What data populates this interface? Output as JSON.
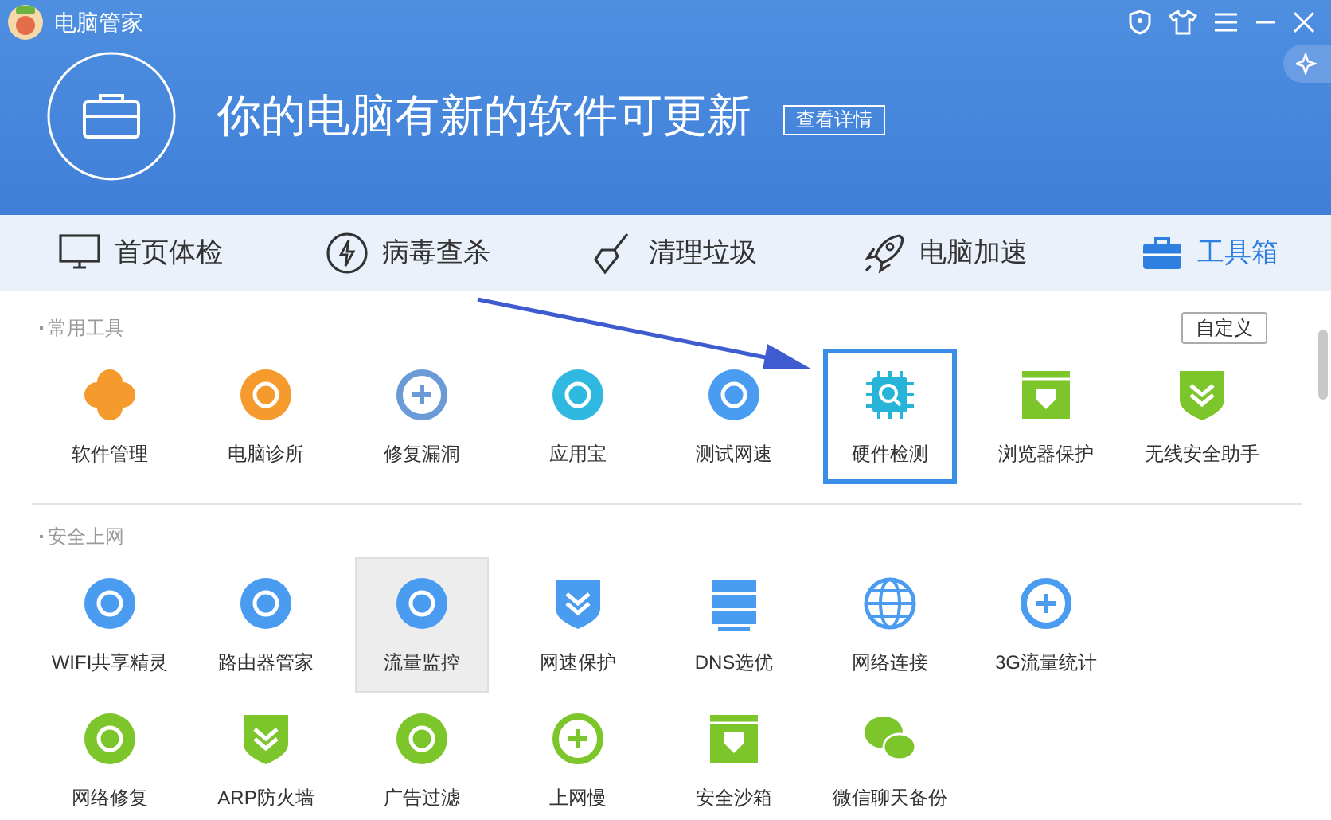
{
  "window": {
    "title": "电脑管家"
  },
  "banner": {
    "headline": "你的电脑有新的软件可更新",
    "button": "查看详情"
  },
  "tabs": [
    {
      "label": "首页体检",
      "selected": false
    },
    {
      "label": "病毒查杀",
      "selected": false
    },
    {
      "label": "清理垃圾",
      "selected": false
    },
    {
      "label": "电脑加速",
      "selected": false
    },
    {
      "label": "工具箱",
      "selected": true
    }
  ],
  "customize_button": "自定义",
  "sections": [
    {
      "title": "常用工具",
      "tools": [
        {
          "label": "软件管理",
          "color": "#f59a2c",
          "selected": false,
          "hovered": false
        },
        {
          "label": "电脑诊所",
          "color": "#f59a2c",
          "selected": false,
          "hovered": false
        },
        {
          "label": "修复漏洞",
          "color": "#6b9bd6",
          "selected": false,
          "hovered": false
        },
        {
          "label": "应用宝",
          "color": "#2fb8e0",
          "selected": false,
          "hovered": false
        },
        {
          "label": "测试网速",
          "color": "#4a9cf0",
          "selected": false,
          "hovered": false
        },
        {
          "label": "硬件检测",
          "color": "#26b4d8",
          "selected": true,
          "hovered": false
        },
        {
          "label": "浏览器保护",
          "color": "#7cc52a",
          "selected": false,
          "hovered": false
        },
        {
          "label": "无线安全助手",
          "color": "#7cc52a",
          "selected": false,
          "hovered": false
        }
      ]
    },
    {
      "title": "安全上网",
      "tools": [
        {
          "label": "WIFI共享精灵",
          "color": "#4a9cf0",
          "selected": false,
          "hovered": false
        },
        {
          "label": "路由器管家",
          "color": "#4a9cf0",
          "selected": false,
          "hovered": false
        },
        {
          "label": "流量监控",
          "color": "#4a9cf0",
          "selected": false,
          "hovered": true
        },
        {
          "label": "网速保护",
          "color": "#4a9cf0",
          "selected": false,
          "hovered": false
        },
        {
          "label": "DNS选优",
          "color": "#4a9cf0",
          "selected": false,
          "hovered": false
        },
        {
          "label": "网络连接",
          "color": "#4a9cf0",
          "selected": false,
          "hovered": false
        },
        {
          "label": "3G流量统计",
          "color": "#4a9cf0",
          "selected": false,
          "hovered": false
        },
        {
          "label": "网络修复",
          "color": "#7cc52a",
          "selected": false,
          "hovered": false
        },
        {
          "label": "ARP防火墙",
          "color": "#7cc52a",
          "selected": false,
          "hovered": false
        },
        {
          "label": "广告过滤",
          "color": "#7cc52a",
          "selected": false,
          "hovered": false
        },
        {
          "label": "上网慢",
          "color": "#7cc52a",
          "selected": false,
          "hovered": false
        },
        {
          "label": "安全沙箱",
          "color": "#7cc52a",
          "selected": false,
          "hovered": false
        },
        {
          "label": "微信聊天备份",
          "color": "#7cc52a",
          "selected": false,
          "hovered": false
        }
      ]
    }
  ]
}
